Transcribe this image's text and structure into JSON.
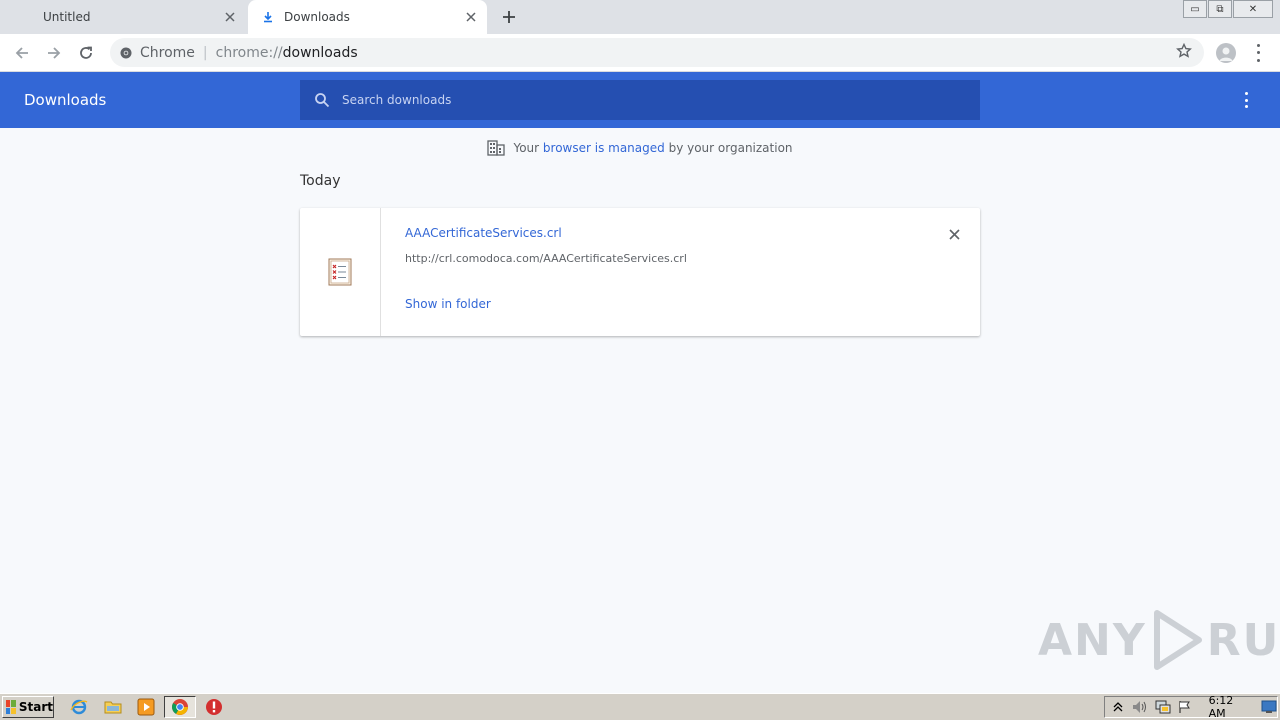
{
  "tabs": [
    {
      "title": "Untitled",
      "active": false
    },
    {
      "title": "Downloads",
      "active": true
    }
  ],
  "window_controls": {
    "minimize": "▭",
    "restore": "⧉",
    "close": "✕"
  },
  "omnibox": {
    "site_label": "Chrome",
    "url_scheme": "chrome://",
    "url_host": "downloads"
  },
  "downloads_page": {
    "title": "Downloads",
    "search_placeholder": "Search downloads",
    "managed_notice": {
      "prefix": "Your ",
      "link": "browser is managed",
      "suffix": " by your organization"
    },
    "sections": [
      {
        "date": "Today",
        "items": [
          {
            "file_name": "AAACertificateServices.crl",
            "url": "http://crl.comodoca.com/AAACertificateServices.crl",
            "action": "Show in folder",
            "icon": "certificate-file-icon"
          }
        ]
      }
    ]
  },
  "watermark": {
    "text_left": "ANY",
    "text_right": "RUN"
  },
  "taskbar": {
    "start_label": "Start",
    "quick_launch": [
      "ie-icon",
      "folder-icon",
      "media-player-icon",
      "chrome-icon",
      "stop-icon"
    ],
    "tray_icons": [
      "show-hidden-icon",
      "volume-icon",
      "network-icon",
      "flag-icon"
    ],
    "clock": "6:12 AM"
  },
  "colors": {
    "accent": "#3367d6",
    "search_bg": "#254fb1",
    "page_bg": "#f7f9fc",
    "tabstrip": "#dee1e6"
  }
}
